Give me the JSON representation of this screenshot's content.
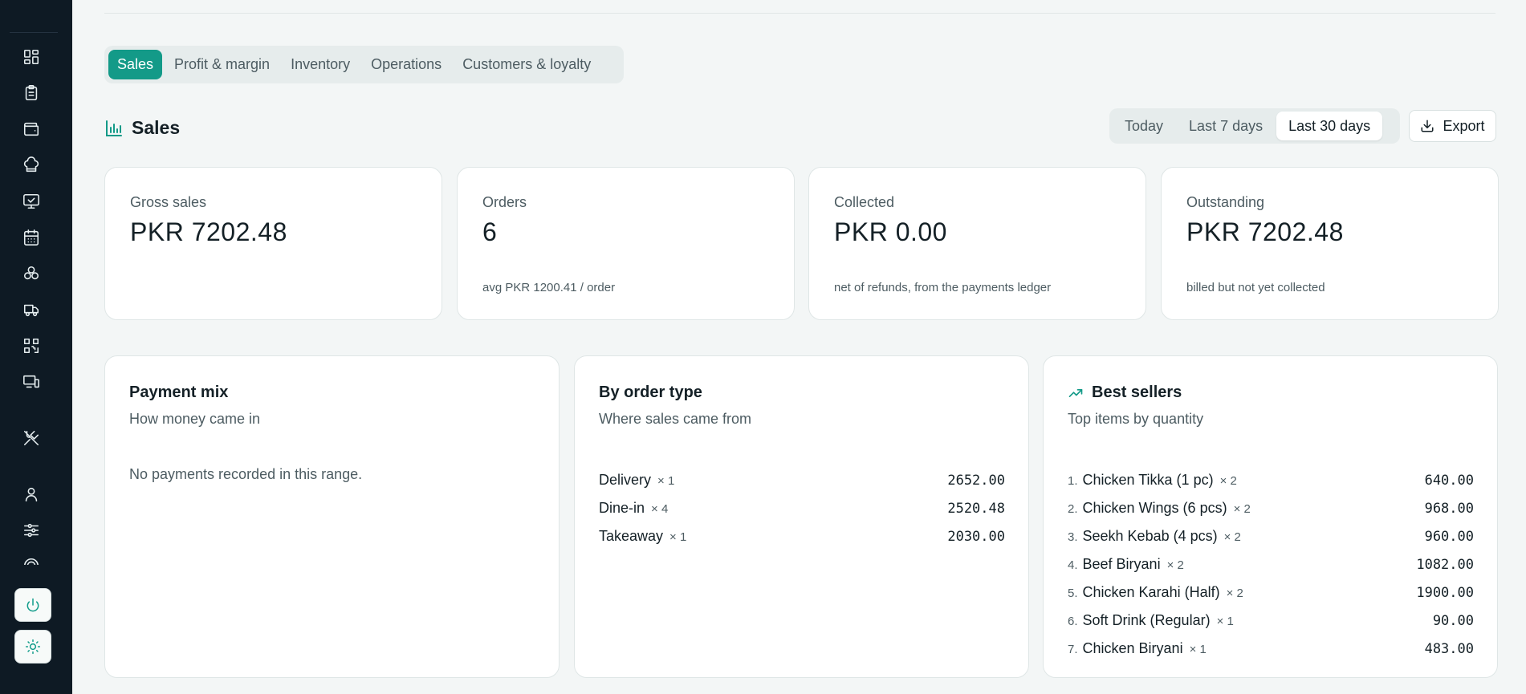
{
  "sidebar": {
    "icons": [
      "dashboard-icon",
      "clipboard-icon",
      "wallet-icon",
      "chef-hat-icon",
      "monitor-icon",
      "calendar-icon",
      "boxes-icon",
      "truck-icon",
      "qr-code-icon",
      "devices-icon",
      "utensils-icon",
      "user-icon",
      "sliders-icon"
    ],
    "power_icon": "power-icon",
    "theme_icon": "sun-icon"
  },
  "tabs": [
    {
      "label": "Sales",
      "active": true
    },
    {
      "label": "Profit & margin",
      "active": false
    },
    {
      "label": "Inventory",
      "active": false
    },
    {
      "label": "Operations",
      "active": false
    },
    {
      "label": "Customers & loyalty",
      "active": false
    }
  ],
  "section": {
    "title": "Sales"
  },
  "ranges": [
    {
      "label": "Today",
      "active": false
    },
    {
      "label": "Last 7 days",
      "active": false
    },
    {
      "label": "Last 30 days",
      "active": true
    }
  ],
  "export_label": "Export",
  "kpis": [
    {
      "label": "Gross sales",
      "value": "PKR 7202.48",
      "sub": ""
    },
    {
      "label": "Orders",
      "value": "6",
      "sub": "avg PKR 1200.41 / order"
    },
    {
      "label": "Collected",
      "value": "PKR 0.00",
      "sub": "net of refunds, from the payments ledger"
    },
    {
      "label": "Outstanding",
      "value": "PKR 7202.48",
      "sub": "billed but not yet collected"
    }
  ],
  "payment_mix": {
    "title": "Payment mix",
    "subtitle": "How money came in",
    "empty": "No payments recorded in this range."
  },
  "order_type": {
    "title": "By order type",
    "subtitle": "Where sales came from",
    "rows": [
      {
        "name": "Delivery",
        "qty": "× 1",
        "amount": "2652.00"
      },
      {
        "name": "Dine-in",
        "qty": "× 4",
        "amount": "2520.48"
      },
      {
        "name": "Takeaway",
        "qty": "× 1",
        "amount": "2030.00"
      }
    ]
  },
  "best_sellers": {
    "title": "Best sellers",
    "subtitle": "Top items by quantity",
    "rows": [
      {
        "rank": "1.",
        "name": "Chicken Tikka (1 pc)",
        "qty": "× 2",
        "amount": "640.00"
      },
      {
        "rank": "2.",
        "name": "Chicken Wings (6 pcs)",
        "qty": "× 2",
        "amount": "968.00"
      },
      {
        "rank": "3.",
        "name": "Seekh Kebab (4 pcs)",
        "qty": "× 2",
        "amount": "960.00"
      },
      {
        "rank": "4.",
        "name": "Beef Biryani",
        "qty": "× 2",
        "amount": "1082.00"
      },
      {
        "rank": "5.",
        "name": "Chicken Karahi (Half)",
        "qty": "× 2",
        "amount": "1900.00"
      },
      {
        "rank": "6.",
        "name": "Soft Drink (Regular)",
        "qty": "× 1",
        "amount": "90.00"
      },
      {
        "rank": "7.",
        "name": "Chicken Biryani",
        "qty": "× 1",
        "amount": "483.00"
      }
    ]
  },
  "colors": {
    "accent": "#139a88",
    "sidebar": "#0e1a24",
    "background": "#f3f6f6"
  }
}
